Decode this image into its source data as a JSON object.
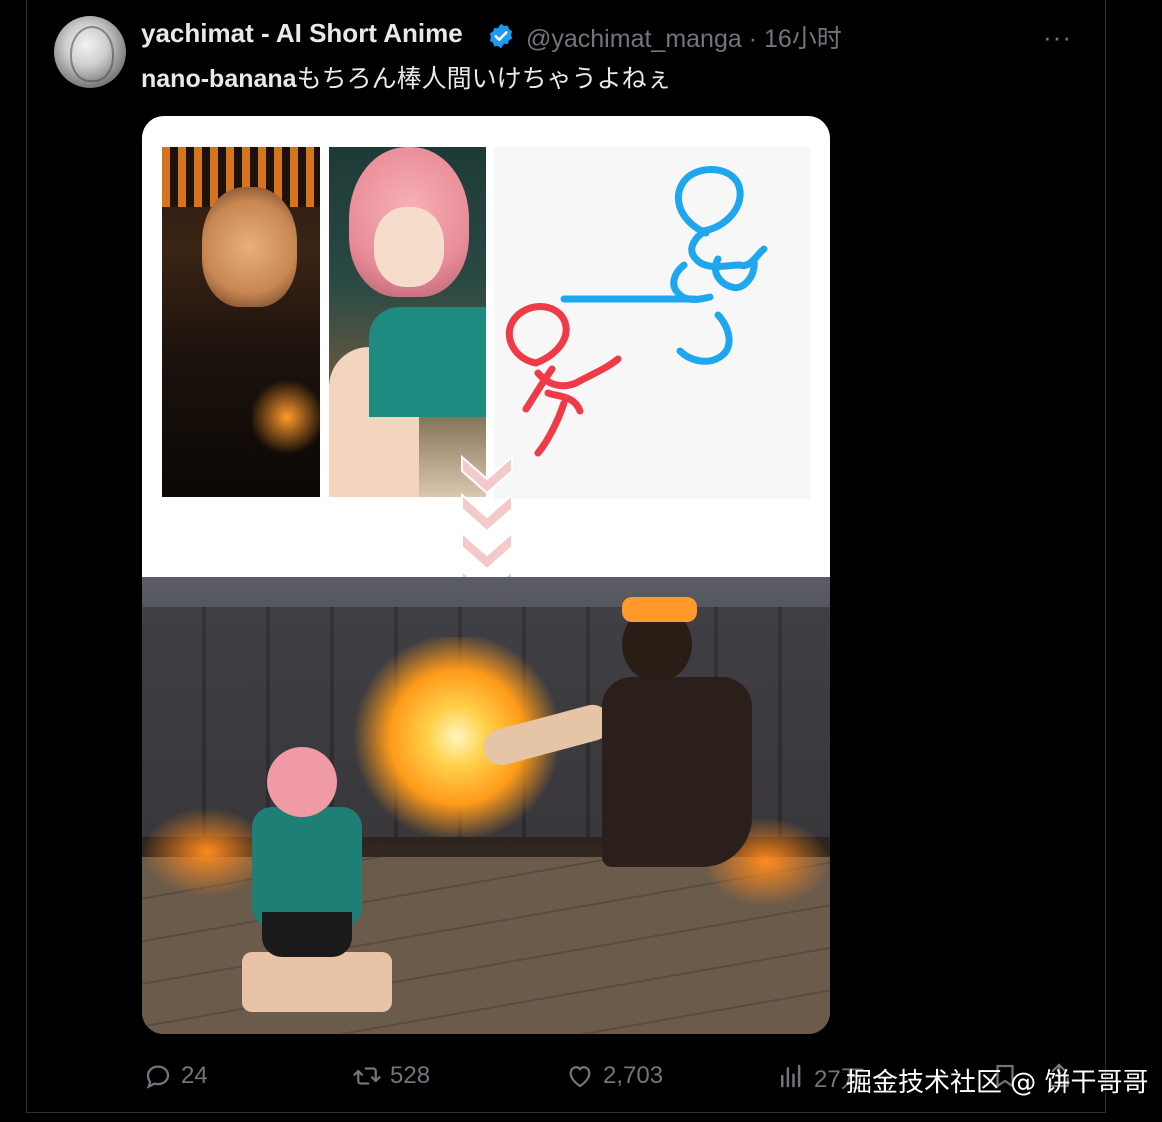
{
  "tweet": {
    "author_name": "yachimat - AI Short Anime",
    "handle": "@yachimat_manga",
    "time": "16小时",
    "text_latin": "nano-banana",
    "text_jp": "もちろん棒人間いけちゃうよねぇ",
    "more_label": "···"
  },
  "actions": {
    "replies": "24",
    "reposts": "528",
    "likes": "2,703",
    "views": "27万"
  },
  "watermark": "掘金技术社区 @ 饼干哥哥",
  "colors": {
    "background": "#000000",
    "text": "#e7e9ea",
    "muted": "#71767b",
    "verified": "#1d9bf0",
    "stick_blue": "#1ea7ee",
    "stick_red": "#ef3b47",
    "arrow_pink": "#f4c9c9"
  },
  "icons": [
    "verified-badge-icon",
    "more-icon",
    "reply-icon",
    "repost-icon",
    "like-icon",
    "views-icon",
    "bookmark-icon",
    "share-icon"
  ]
}
